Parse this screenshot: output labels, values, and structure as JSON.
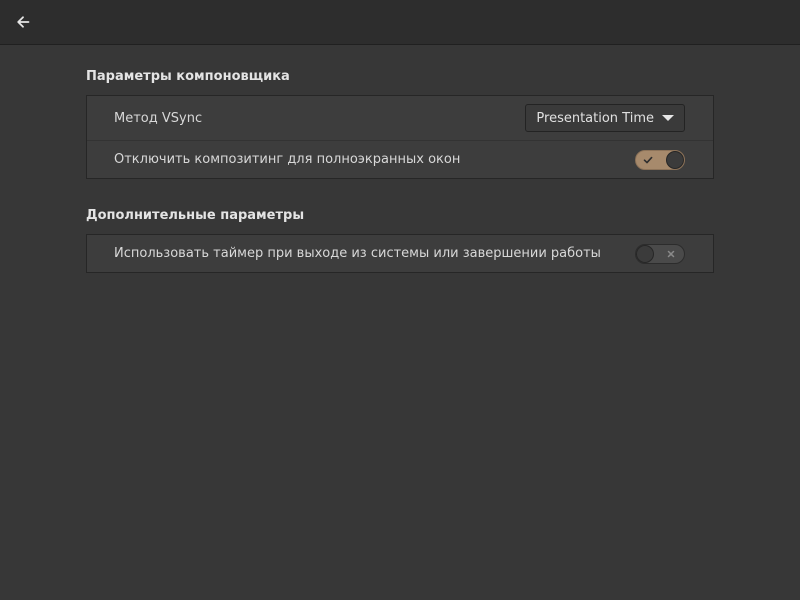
{
  "header": {
    "back_icon": "arrow-left-icon"
  },
  "compositor": {
    "title": "Параметры компоновщика",
    "vsync_label": "Метод VSync",
    "vsync_value": "Presentation Time",
    "fullscreen_label": "Отключить композитинг для полноэкранных окон",
    "fullscreen_enabled": true
  },
  "advanced": {
    "title": "Дополнительные параметры",
    "logout_timer_label": "Использовать таймер при выходе из системы или завершении работы",
    "logout_timer_enabled": false
  },
  "colors": {
    "window_bg": "#373737",
    "header_bg": "#2d2d2d",
    "frame_bg": "#3d3d3d",
    "switch_on": "#a78a6c",
    "switch_off": "#4a4a4a"
  }
}
